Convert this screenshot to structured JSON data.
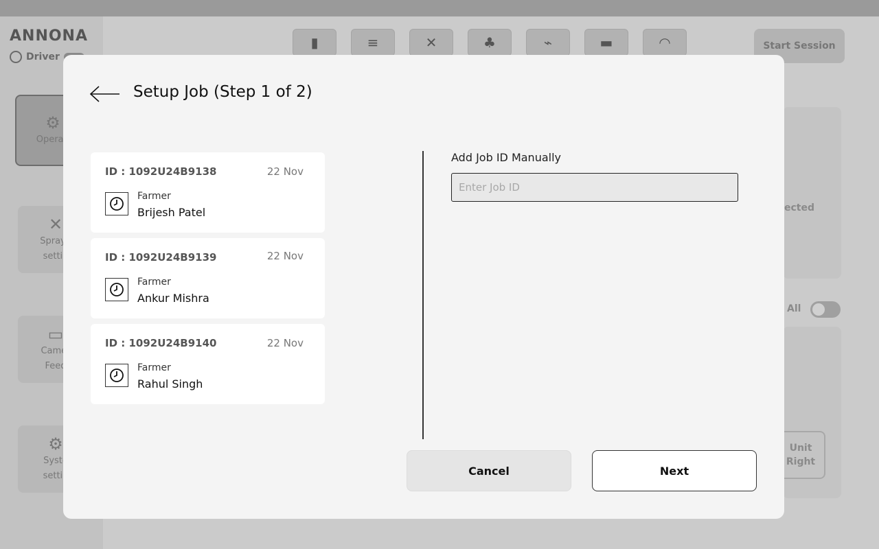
{
  "background": {
    "brand": "ANNONA",
    "driver_label": "Driver",
    "sidebar_items": [
      {
        "label": "Operati",
        "icon": "sliders-icon"
      },
      {
        "label": "Spraye\nsettin",
        "icon": "sprayer-icon"
      },
      {
        "label": "Camer\nFeed",
        "icon": "camera-icon"
      },
      {
        "label": "Syste\nsettin",
        "icon": "gear-icon"
      }
    ],
    "start_session": "Start Session",
    "fragment_detected": "ected",
    "fragment_all": "All",
    "unit_right": "Unit\nRight"
  },
  "modal": {
    "title": "Setup Job (Step 1 of 2)",
    "jobs": [
      {
        "id": "ID : 1092U24B9138",
        "date": "22 Nov",
        "farmer_label": "Farmer",
        "farmer_name": "Brijesh Patel"
      },
      {
        "id": "ID : 1092U24B9139",
        "date": "22 Nov",
        "farmer_label": "Farmer",
        "farmer_name": "Ankur Mishra"
      },
      {
        "id": "ID : 1092U24B9140",
        "date": "22 Nov",
        "farmer_label": "Farmer",
        "farmer_name": "Rahul Singh"
      }
    ],
    "manual_label": "Add Job ID Manually",
    "input_placeholder": "Enter Job ID",
    "cancel_label": "Cancel",
    "next_label": "Next"
  },
  "colors": {
    "overlay": "#cdcdcd",
    "modal_bg": "#f4f4f4",
    "card_bg": "#ffffff"
  }
}
